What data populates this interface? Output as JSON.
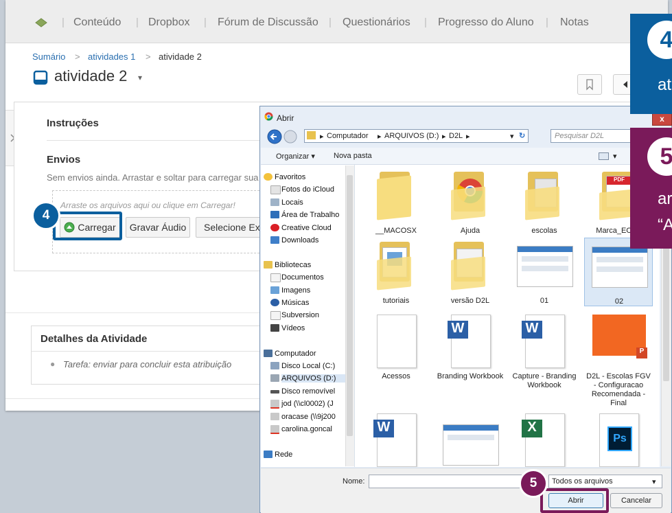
{
  "nav": {
    "items": [
      "Conteúdo",
      "Dropbox",
      "Fórum de Discussão",
      "Questionários",
      "Progresso do Aluno",
      "Notas"
    ],
    "separator": "|"
  },
  "breadcrumb": {
    "items": [
      "Sumário",
      "atividades 1",
      "atividade 2"
    ],
    "separator": ">"
  },
  "page": {
    "title": "atividade 2",
    "title_arrow": "▾"
  },
  "instructions": {
    "heading": "Instruções"
  },
  "submissions": {
    "heading": "Envios",
    "empty_text": "Sem envios ainda. Arrastar e soltar para carregar sua",
    "drop_hint": "Arraste os arquivos aqui ou clique em Carregar!",
    "upload_label": "Carregar",
    "record_audio_label": "Gravar Áudio",
    "select_existing_label": "Selecione Exis"
  },
  "details": {
    "heading": "Detalhes da Atividade",
    "task_text": "Tarefa: enviar para concluir esta atribuição"
  },
  "dialog": {
    "title": "Abrir",
    "path": [
      "Computador",
      "ARQUIVOS (D:)",
      "D2L"
    ],
    "search_placeholder": "Pesquisar D2L",
    "organize_label": "Organizar ▾",
    "new_folder_label": "Nova pasta",
    "tree": [
      {
        "label": "Favoritos",
        "icon": "star-icon"
      },
      {
        "label": "Fotos do iCloud",
        "icon": "photos-icon"
      },
      {
        "label": "Locais",
        "icon": "places-icon"
      },
      {
        "label": "Área de Trabalho",
        "icon": "desktop-icon"
      },
      {
        "label": "Creative Cloud",
        "icon": "creative-cloud-icon"
      },
      {
        "label": "Downloads",
        "icon": "downloads-icon"
      },
      {
        "label": "Bibliotecas",
        "icon": "libraries-icon"
      },
      {
        "label": "Documentos",
        "icon": "documents-icon"
      },
      {
        "label": "Imagens",
        "icon": "images-icon"
      },
      {
        "label": "Músicas",
        "icon": "music-icon"
      },
      {
        "label": "Subversion",
        "icon": "subversion-icon"
      },
      {
        "label": "Vídeos",
        "icon": "videos-icon"
      },
      {
        "label": "Computador",
        "icon": "computer-icon"
      },
      {
        "label": "Disco Local (C:)",
        "icon": "disk-icon"
      },
      {
        "label": "ARQUIVOS (D:)",
        "icon": "disk-icon"
      },
      {
        "label": "Disco removível",
        "icon": "removable-disk-icon"
      },
      {
        "label": "jod (\\\\cl0002) (J",
        "icon": "network-drive-icon"
      },
      {
        "label": "oracase (\\\\9j200",
        "icon": "network-drive-icon"
      },
      {
        "label": "carolina.goncal",
        "icon": "network-drive-icon"
      },
      {
        "label": "Rede",
        "icon": "network-icon"
      }
    ],
    "files": [
      {
        "name": "__MACOSX",
        "type": "folder"
      },
      {
        "name": "Ajuda",
        "type": "folder-chrome"
      },
      {
        "name": "escolas",
        "type": "folder"
      },
      {
        "name": "Marca_ECLA",
        "type": "folder-pdf"
      },
      {
        "name": "tutoriais",
        "type": "folder-image"
      },
      {
        "name": "versão D2L",
        "type": "folder-docs"
      },
      {
        "name": "01",
        "type": "image"
      },
      {
        "name": "02",
        "type": "image"
      },
      {
        "name": "Acessos",
        "type": "blank-doc"
      },
      {
        "name": "Branding Workbook",
        "type": "word"
      },
      {
        "name": "Capture - Branding Workbook",
        "type": "word"
      },
      {
        "name": "D2L - Escolas FGV - Configuracao Recomendada - Final",
        "type": "powerpoint"
      },
      {
        "name": "",
        "type": "word"
      },
      {
        "name": "",
        "type": "image"
      },
      {
        "name": "",
        "type": "excel"
      },
      {
        "name": "",
        "type": "photoshop"
      }
    ],
    "filename_label": "Nome:",
    "filetype_value": "Todos os arquivos",
    "open_label": "Abrir",
    "cancel_label": "Cancelar",
    "close_glyph": "x"
  },
  "callouts": {
    "step4": "4",
    "step5": "5",
    "right4_num": "4",
    "right4_text": "at",
    "right5_num": "5",
    "right5_line1": "ar",
    "right5_line2": "“A"
  },
  "colors": {
    "callout_blue": "#0b5f9e",
    "callout_purple": "#7a1a5a",
    "link": "#2a6fb0"
  }
}
